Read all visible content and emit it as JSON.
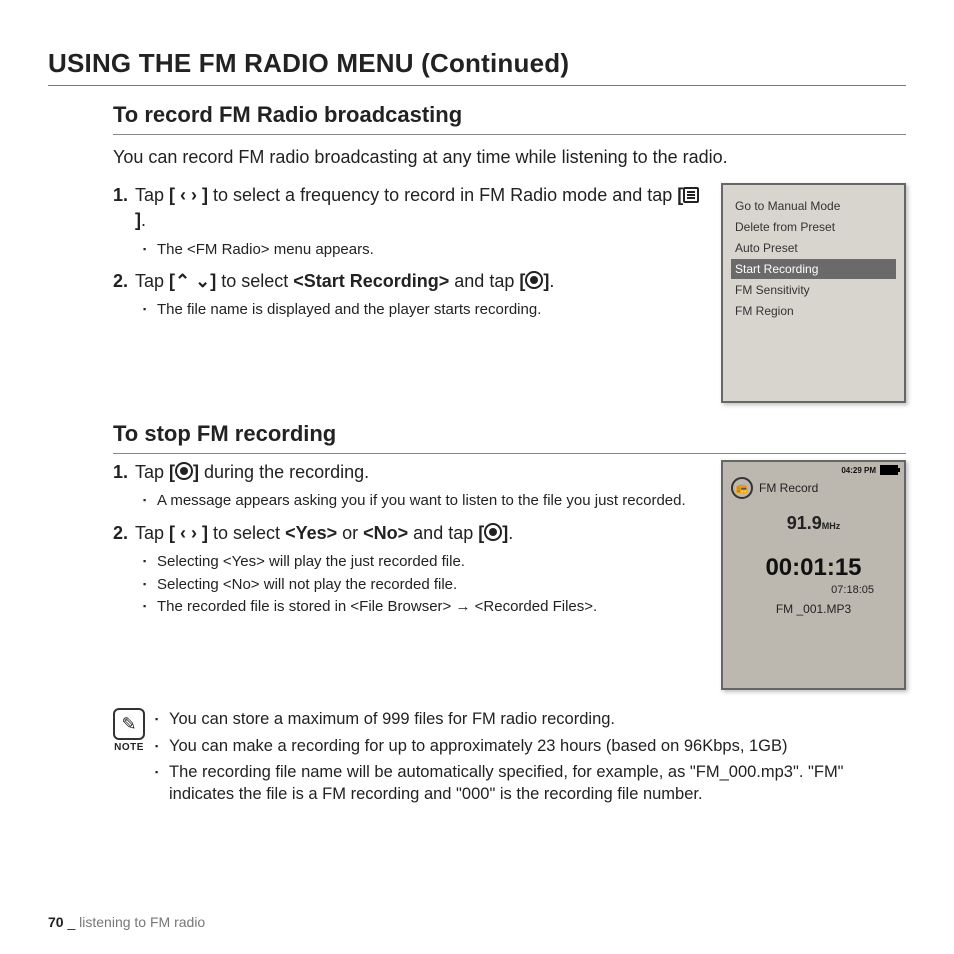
{
  "title": "USING THE FM RADIO MENU (Continued)",
  "section1": {
    "heading": "To record FM Radio broadcasting",
    "intro": "You can record FM radio broadcasting at any time while listening to the radio.",
    "steps": [
      {
        "prefix": "Tap ",
        "control": "[ ‹  › ]",
        "middle": " to select a frequency to record in FM Radio mode and tap ",
        "control2": "[",
        "control2end": "]",
        "after": ".",
        "sub": [
          "The <FM Radio> menu appears."
        ]
      },
      {
        "prefix": "Tap ",
        "control": "[⌃ ⌄]",
        "middle": " to select ",
        "bold": "<Start Recording>",
        "middle2": " and tap ",
        "control2": "[",
        "control2end": "]",
        "after": ".",
        "sub": [
          "The file name is displayed and the player starts recording."
        ]
      }
    ]
  },
  "menu_device": {
    "items": [
      "Go to Manual Mode",
      "Delete from Preset",
      "Auto Preset",
      "Start Recording",
      "FM Sensitivity",
      "FM Region"
    ],
    "selected_index": 3
  },
  "section2": {
    "heading": "To stop FM recording",
    "steps": [
      {
        "prefix": "Tap ",
        "control": "[",
        "controlend": "]",
        "after": " during the recording.",
        "sub": [
          "A message appears asking you if you want to listen to the file you just recorded."
        ]
      },
      {
        "prefix": "Tap ",
        "control": "[ ‹  › ]",
        "middle": " to select ",
        "bold": "<Yes>",
        "middle2": " or ",
        "bold2": "<No>",
        "middle3": " and tap ",
        "control2": "[",
        "control2end": "]",
        "after": ".",
        "sub": [
          "Selecting <Yes> will play the just recorded file.",
          "Selecting <No> will not play the recorded file.",
          "The recorded file is stored in <File Browser> → <Recorded Files>."
        ]
      }
    ]
  },
  "record_device": {
    "time": "04:29 PM",
    "title": "FM Record",
    "freq": "91.9",
    "freq_unit": "MHz",
    "overlay": "",
    "timer": "00:01:15",
    "elapsed": "07:18:05",
    "filename": "FM _001.MP3"
  },
  "note": {
    "label": "NOTE",
    "items": [
      "You can store a maximum of 999 files for FM radio recording.",
      "You can make a recording for up to approximately 23 hours (based on 96Kbps, 1GB)",
      "The recording file name will be automatically specified, for example, as \"FM_000.mp3\". \"FM\" indicates the file is a FM recording and \"000\" is the recording file number."
    ]
  },
  "footer": {
    "page": "70",
    "sep": " _ ",
    "title": "listening to FM radio"
  }
}
